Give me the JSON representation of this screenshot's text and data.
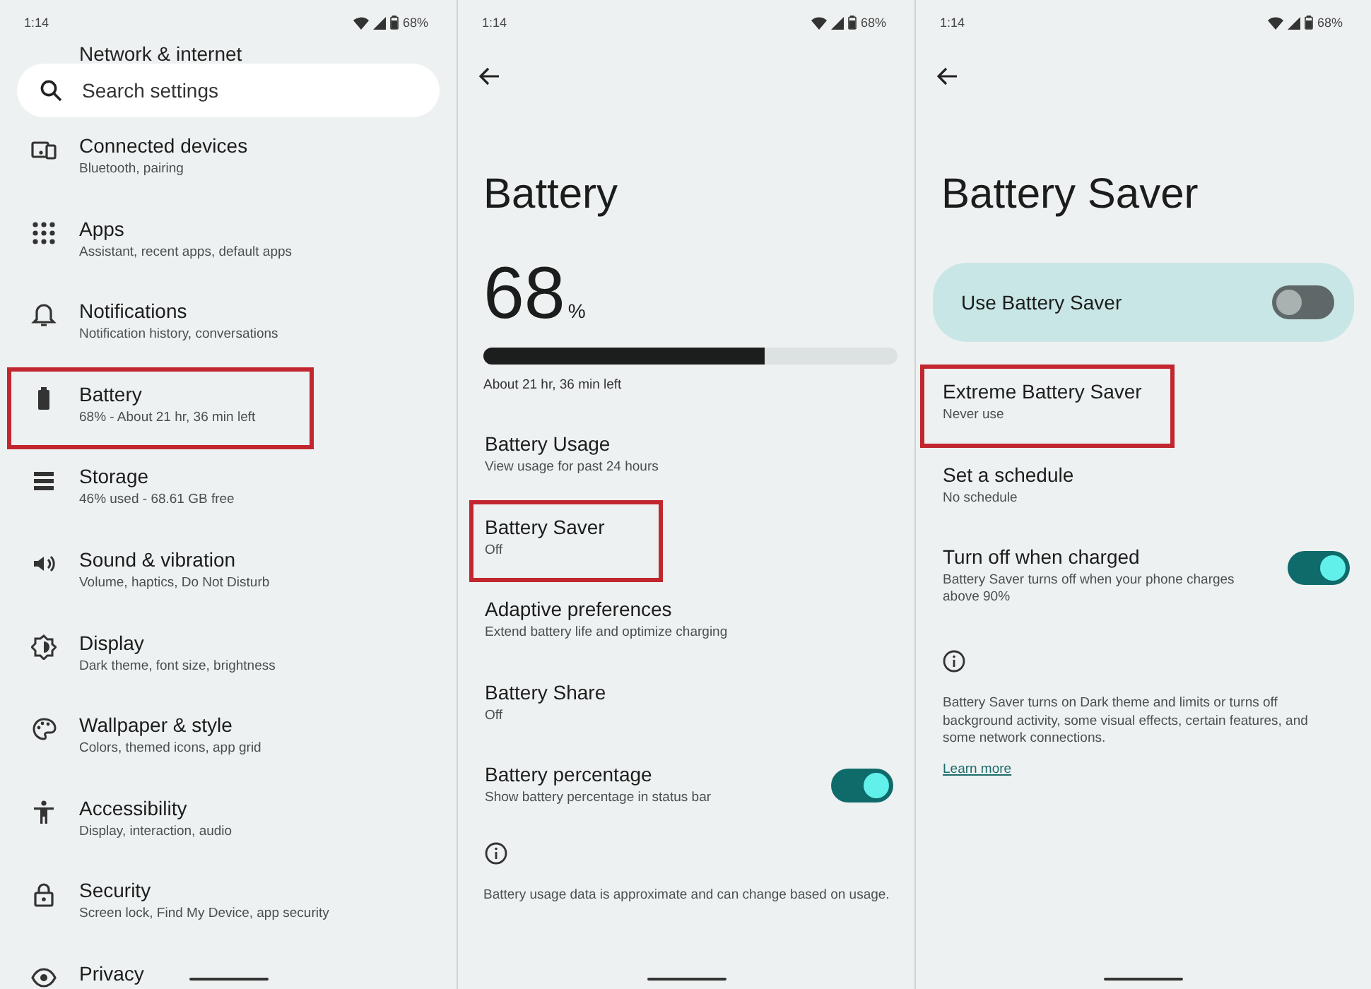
{
  "settings_screen": {
    "status_bar": {
      "time": "1:14",
      "battery": "68%"
    },
    "partial_item": "Network & internet",
    "search": {
      "placeholder": "Search settings"
    },
    "items": [
      {
        "title": "Connected devices",
        "subtitle": "Bluetooth, pairing",
        "highlighted": false
      },
      {
        "title": "Apps",
        "subtitle": "Assistant, recent apps, default apps",
        "highlighted": false
      },
      {
        "title": "Notifications",
        "subtitle": "Notification history, conversations",
        "highlighted": false
      },
      {
        "title": "Battery",
        "subtitle": "68% - About 21 hr, 36 min left",
        "highlighted": true
      },
      {
        "title": "Storage",
        "subtitle": "46% used - 68.61 GB free",
        "highlighted": false
      },
      {
        "title": "Sound & vibration",
        "subtitle": "Volume, haptics, Do Not Disturb",
        "highlighted": false
      },
      {
        "title": "Display",
        "subtitle": "Dark theme, font size, brightness",
        "highlighted": false
      },
      {
        "title": "Wallpaper & style",
        "subtitle": "Colors, themed icons, app grid",
        "highlighted": false
      },
      {
        "title": "Accessibility",
        "subtitle": "Display, interaction, audio",
        "highlighted": false
      },
      {
        "title": "Security",
        "subtitle": "Screen lock, Find My Device, app security",
        "highlighted": false
      },
      {
        "title": "Privacy",
        "highlighted": false
      }
    ]
  },
  "battery_screen": {
    "status_bar": {
      "time": "1:14",
      "battery": "68%"
    },
    "title": "Battery",
    "percent": "68",
    "percent_sign": "%",
    "level": 0.68,
    "remaining": "About 21 hr, 36 min left",
    "items": [
      {
        "kind": "link",
        "title": "Battery Usage",
        "subtitle": "View usage for past 24 hours",
        "highlighted": false
      },
      {
        "kind": "link",
        "title": "Battery Saver",
        "subtitle": "Off",
        "highlighted": true
      },
      {
        "kind": "link",
        "title": "Adaptive preferences",
        "subtitle": "Extend battery life and optimize charging",
        "highlighted": false
      },
      {
        "kind": "link",
        "title": "Battery Share",
        "subtitle": "Off",
        "highlighted": false
      },
      {
        "kind": "switch",
        "title": "Battery percentage",
        "subtitle": "Show battery percentage in status bar",
        "highlighted": false,
        "on": true
      }
    ],
    "footer": "Battery usage data is approximate and can change based on usage."
  },
  "battery_saver_screen": {
    "status_bar": {
      "time": "1:14",
      "battery": "68%"
    },
    "title": "Battery Saver",
    "main_switch": {
      "label": "Use Battery Saver",
      "on": false
    },
    "items": [
      {
        "kind": "link",
        "title": "Extreme Battery Saver",
        "subtitle": "Never use",
        "highlighted": true
      },
      {
        "kind": "link",
        "title": "Set a schedule",
        "subtitle": "No schedule",
        "highlighted": false
      },
      {
        "kind": "switch",
        "title": "Turn off when charged",
        "subtitle": "Battery Saver turns off when your phone charges above 90%",
        "highlighted": false,
        "on": true
      }
    ],
    "footer": "Battery Saver turns on Dark theme and limits or turns off background activity, some visual effects, certain features, and some network connections.",
    "link": "Learn more"
  }
}
